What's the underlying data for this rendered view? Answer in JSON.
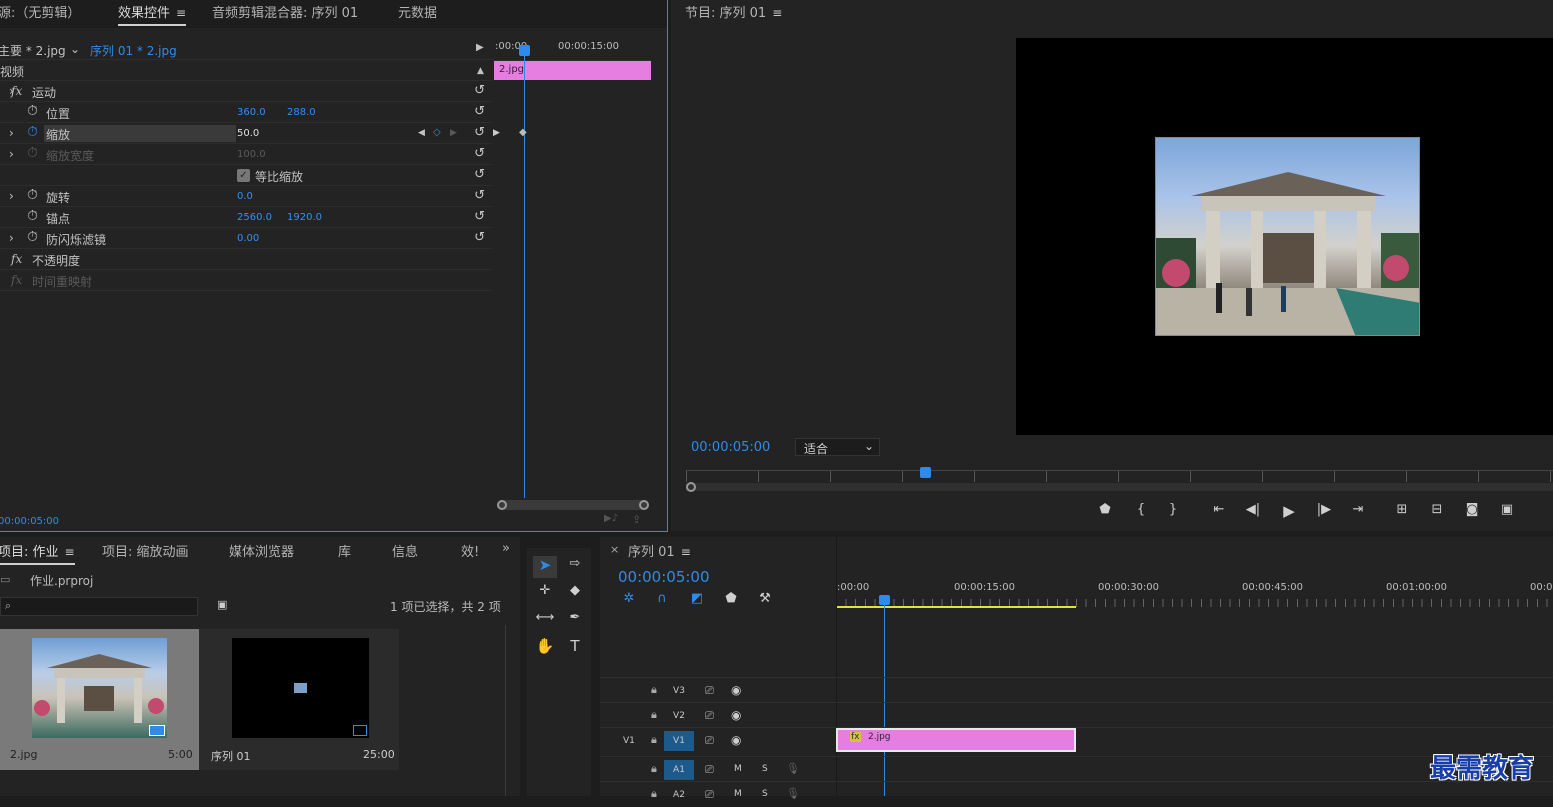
{
  "effect_panel": {
    "tabs": [
      "源:（无剪辑）",
      "效果控件",
      "音频剪辑混合器: 序列 01",
      "元数据"
    ],
    "master": "主要 * 2.jpg",
    "sequence": "序列 01 * 2.jpg",
    "ruler_start": ":00:00",
    "ruler_mid": "00:00:15:00",
    "clip": "2.jpg",
    "section_video": "视频",
    "timecode": "00:00:05:00",
    "props": [
      {
        "name": "运动",
        "fx": true
      },
      {
        "name": "位置",
        "v1": "360.0",
        "v2": "288.0"
      },
      {
        "name": "缩放",
        "v1": "50.0"
      },
      {
        "name": "缩放宽度",
        "v1": "100.0"
      },
      {
        "name": "等比缩放"
      },
      {
        "name": "旋转",
        "v1": "0.0"
      },
      {
        "name": "锚点",
        "v1": "2560.0",
        "v2": "1920.0"
      },
      {
        "name": "防闪烁滤镜",
        "v1": "0.00"
      },
      {
        "name": "不透明度",
        "fx": true
      },
      {
        "name": "时间重映射",
        "fx": true
      }
    ]
  },
  "program": {
    "title": "节目: 序列 01",
    "timecode": "00:00:05:00",
    "fit": "适合"
  },
  "project": {
    "tabs": [
      "项目: 作业",
      "项目: 缩放动画",
      "媒体浏览器",
      "库",
      "信息",
      "效!"
    ],
    "file": "作业.prproj",
    "selection": "1 项已选择，共 2 项",
    "items": [
      {
        "name": "2.jpg",
        "dur": "5:00"
      },
      {
        "name": "序列 01",
        "dur": "25:00"
      }
    ]
  },
  "timeline": {
    "title": "序列 01",
    "timecode": "00:00:05:00",
    "ruler": [
      ":00:00",
      "00:00:15:00",
      "00:00:30:00",
      "00:00:45:00",
      "00:01:00:00",
      "00:0"
    ],
    "tracks": [
      {
        "id": "V3"
      },
      {
        "id": "V2"
      },
      {
        "id": "V1",
        "src": "V1"
      },
      {
        "id": "A1",
        "m": "M",
        "s": "S"
      },
      {
        "id": "A2",
        "m": "M",
        "s": "S"
      }
    ],
    "clip": "2.jpg"
  },
  "watermark": "最需教育",
  "colors": {
    "accent": "#2d8ceb",
    "clip": "#e57ee0"
  }
}
